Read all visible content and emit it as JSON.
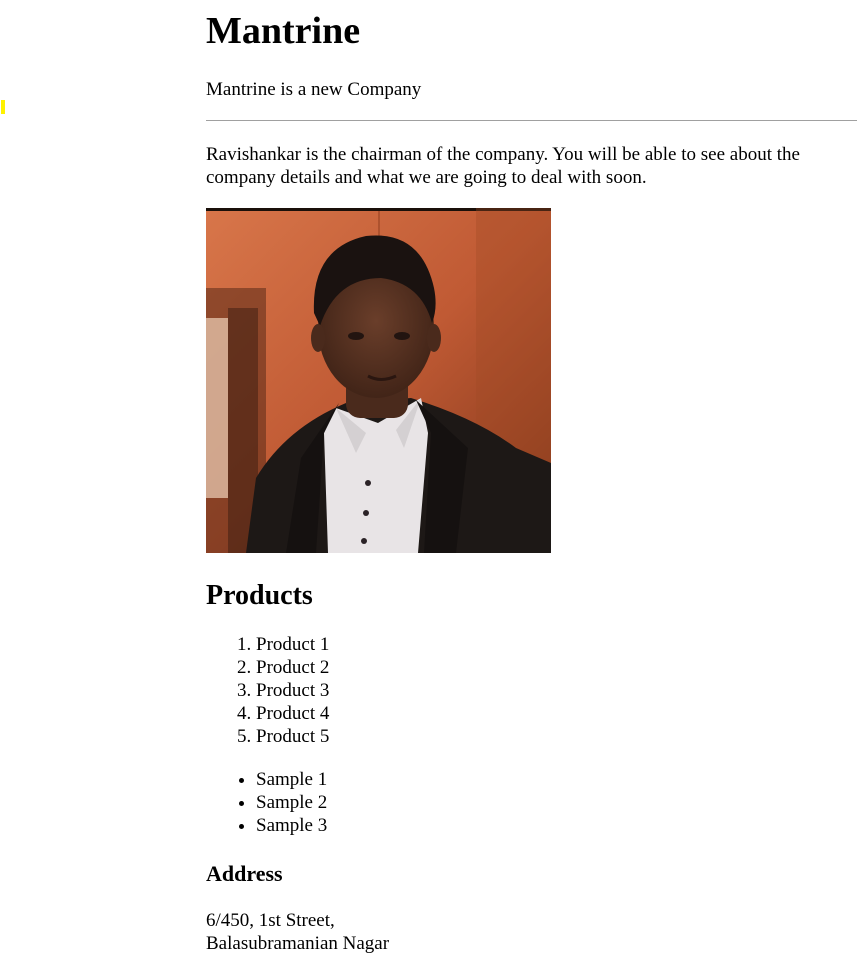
{
  "header": {
    "title": "Mantrine",
    "tagline": "Mantrine is a new Company"
  },
  "intro": {
    "text": "Ravishankar is the chairman of the company. You will be able to see about the company details and what we are going to deal with soon."
  },
  "photo": {
    "colors": {
      "wall": "#c9653d",
      "wall_dark": "#8a3a1e",
      "suit": "#1d1816",
      "shirt": "#e8e4e6",
      "skin": "#5a3424",
      "hair": "#1a1210",
      "edge": "#2a1a12"
    }
  },
  "products": {
    "heading": "Products",
    "ordered": [
      "Product 1",
      "Product 2",
      "Product 3",
      "Product 4",
      "Product 5"
    ],
    "unordered": [
      "Sample 1",
      "Sample 2",
      "Sample 3"
    ]
  },
  "address": {
    "heading": "Address",
    "line1": "6/450, 1st Street,",
    "line2": "Balasubramanian Nagar"
  },
  "colors": {
    "marker": "#fff200",
    "rule": "#a0a0a0",
    "text": "#000000"
  }
}
